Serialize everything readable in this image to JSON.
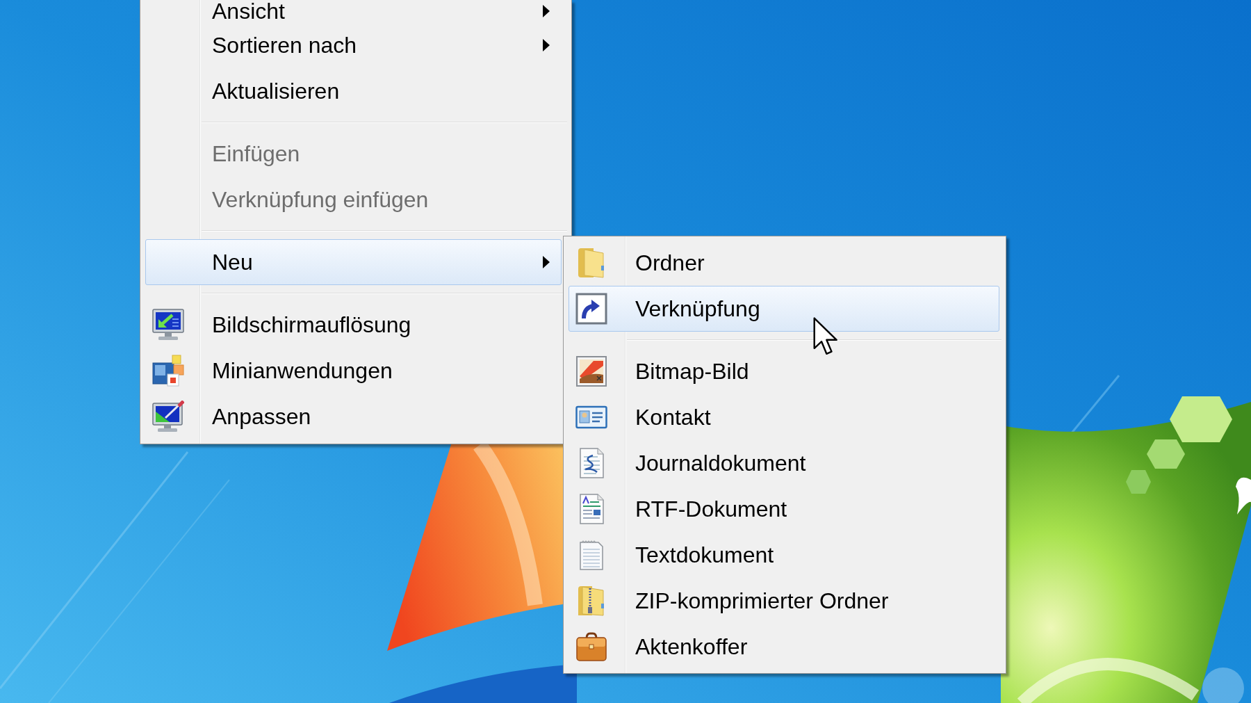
{
  "context_menu": {
    "items": [
      {
        "kind": "item",
        "label": "Ansicht",
        "disabled": false,
        "selected": false,
        "submenu": true
      },
      {
        "kind": "item",
        "label": "Sortieren nach",
        "disabled": false,
        "selected": false,
        "submenu": true
      },
      {
        "kind": "item",
        "label": "Aktualisieren",
        "disabled": false,
        "selected": false,
        "submenu": false
      },
      {
        "kind": "separator"
      },
      {
        "kind": "item",
        "label": "Einfügen",
        "disabled": true,
        "selected": false,
        "submenu": false
      },
      {
        "kind": "item",
        "label": "Verknüpfung einfügen",
        "disabled": true,
        "selected": false,
        "submenu": false
      },
      {
        "kind": "separator"
      },
      {
        "kind": "item",
        "label": "Neu",
        "disabled": false,
        "selected": true,
        "submenu": true
      },
      {
        "kind": "separator"
      },
      {
        "kind": "item",
        "label": "Bildschirmauflösung",
        "disabled": false,
        "selected": false,
        "submenu": false
      },
      {
        "kind": "item",
        "label": "Minianwendungen",
        "disabled": false,
        "selected": false,
        "submenu": false
      },
      {
        "kind": "item",
        "label": "Anpassen",
        "disabled": false,
        "selected": false,
        "submenu": false
      }
    ]
  },
  "submenu": {
    "items": [
      {
        "kind": "item",
        "label": "Ordner",
        "disabled": false,
        "selected": false
      },
      {
        "kind": "item",
        "label": "Verknüpfung",
        "disabled": false,
        "selected": true
      },
      {
        "kind": "separator"
      },
      {
        "kind": "item",
        "label": "Bitmap-Bild",
        "disabled": false,
        "selected": false
      },
      {
        "kind": "item",
        "label": "Kontakt",
        "disabled": false,
        "selected": false
      },
      {
        "kind": "item",
        "label": "Journaldokument",
        "disabled": false,
        "selected": false
      },
      {
        "kind": "item",
        "label": "RTF-Dokument",
        "disabled": false,
        "selected": false
      },
      {
        "kind": "item",
        "label": "Textdokument",
        "disabled": false,
        "selected": false
      },
      {
        "kind": "item",
        "label": "ZIP-komprimierter Ordner",
        "disabled": false,
        "selected": false
      },
      {
        "kind": "item",
        "label": "Aktenkoffer",
        "disabled": false,
        "selected": false
      }
    ]
  }
}
